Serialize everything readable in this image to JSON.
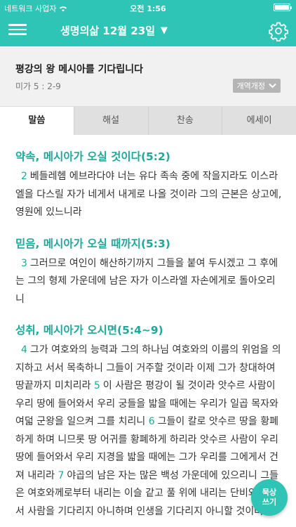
{
  "status_bar": {
    "carrier": "네트워크 사업자",
    "time": "오전 1:56",
    "battery_level": 1.0
  },
  "header": {
    "title": "생명의삶 12월  23일",
    "arrow": "▼",
    "menu_icon": "hamburger-icon",
    "settings_icon": "gear-icon"
  },
  "passage": {
    "title": "평강의 왕 메시아를 기다립니다",
    "reference": "미가 5 : 2-9",
    "version_label": "개역개정"
  },
  "tabs": [
    {
      "label": "말씀",
      "active": true
    },
    {
      "label": "해설",
      "active": false
    },
    {
      "label": "찬송",
      "active": false
    },
    {
      "label": "에세이",
      "active": false
    }
  ],
  "sections": [
    {
      "heading": "약속, 메시아가 오실 것이다(5:2)",
      "verses": [
        {
          "num": "2",
          "text": "베들레헴 에브라다야 너는 유다 족속 중에 작을지라도 이스라엘을 다스릴 자가 네게서 내게로 나올 것이라 그의 근본은 상고에, 영원에 있느니라"
        }
      ]
    },
    {
      "heading": "믿음, 메시아가 오실 때까지(5:3)",
      "verses": [
        {
          "num": "3",
          "text": "그러므로 여인이 해산하기까지 그들을 붙여 두시겠고 그 후에는 그의 형제 가운데에 남은 자가 이스라엘 자손에게로 돌아오리니"
        }
      ]
    },
    {
      "heading": "성취, 메시아가 오시면(5:4~9)",
      "verses": [
        {
          "num": "4",
          "text": "그가 여호와의 능력과 그의 하나님 여호와의 이름의 위엄을 의지하고 서서 목축하니 그들이 거주할 것이라 이제 그가 창대하여 땅끝까지 미치리라"
        },
        {
          "num": "5",
          "text": "이 사람은 평강이 될 것이라 앗수르 사람이 우리 땅에 들어와서 우리 궁들을 밟을 때에는 우리가 일곱 목자와 여덟 군왕을 일으켜 그를 치리니"
        },
        {
          "num": "6",
          "text": "그들이 칼로 앗수르 땅을 황폐하게 하며 니므롯 땅 어귀를 황폐하게 하리라 앗수르 사람이 우리 땅에 들어와서 우리 지경을 밟을 때에는 그가 우리를 그에게서 건져 내리라"
        },
        {
          "num": "7",
          "text": "야곱의 남은 자는 많은 백성 가운데에 있으리니 그들은 여호와께로부터 내리는 이슬 같고 풀 위에 내리는 단비와 같아서 사람을 기다리지 아니하며 인생을 기다리지 아니할 것이며"
        }
      ]
    }
  ],
  "fab": {
    "line1": "묵상",
    "line2": "쓰기"
  },
  "colors": {
    "accent": "#2ec4b6",
    "heading": "#1fa89a"
  }
}
